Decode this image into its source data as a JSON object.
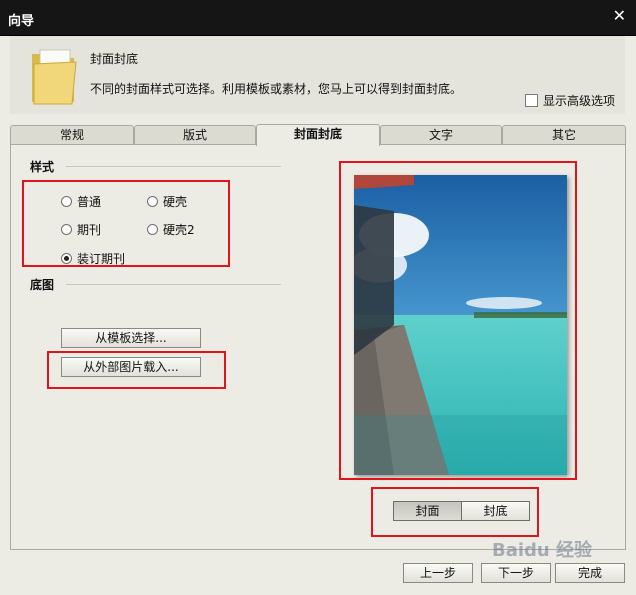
{
  "window": {
    "title": "向导"
  },
  "header": {
    "title": "封面封底",
    "description": "不同的封面样式可选择。利用模板或素材，您马上可以得到封面封底。",
    "advanced_option_label": "显示高级选项",
    "advanced_option_checked": false
  },
  "tabs": [
    {
      "label": "常规"
    },
    {
      "label": "版式"
    },
    {
      "label": "封面封底",
      "active": true
    },
    {
      "label": "文字"
    },
    {
      "label": "其它"
    }
  ],
  "style_section": {
    "heading": "样式",
    "options": [
      {
        "label": "普通",
        "selected": false
      },
      {
        "label": "硬壳",
        "selected": false
      },
      {
        "label": "期刊",
        "selected": false
      },
      {
        "label": "硬壳2",
        "selected": false
      },
      {
        "label": "装订期刊",
        "selected": true
      }
    ]
  },
  "background_section": {
    "heading": "底图",
    "from_template_label": "从模板选择...",
    "from_external_label": "从外部图片载入..."
  },
  "preview_toggle": {
    "front_label": "封面",
    "back_label": "封底",
    "selected": "封面"
  },
  "footer": {
    "prev_label": "上一步",
    "next_label": "下一步",
    "finish_label": "完成"
  },
  "watermark": {
    "text": "Baidu 经验"
  },
  "colors": {
    "highlight_red": "#e0141d",
    "titlebar": "#151515"
  }
}
